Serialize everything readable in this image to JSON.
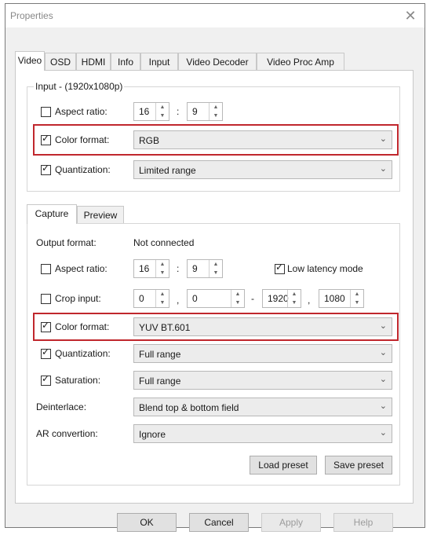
{
  "window": {
    "title": "Properties",
    "close_glyph": "✕"
  },
  "tabs": [
    {
      "label": "Video"
    },
    {
      "label": "OSD"
    },
    {
      "label": "HDMI"
    },
    {
      "label": "Info"
    },
    {
      "label": "Input"
    },
    {
      "label": "Video Decoder"
    },
    {
      "label": "Video Proc Amp"
    }
  ],
  "input_group": {
    "title": "Input - (1920x1080p)",
    "aspect_ratio": {
      "label": "Aspect ratio:",
      "checked": false,
      "a": "16",
      "b": "9"
    },
    "color_format": {
      "label": "Color format:",
      "checked": true,
      "value": "RGB"
    },
    "quantization": {
      "label": "Quantization:",
      "checked": true,
      "value": "Limited range"
    }
  },
  "inner_tabs": [
    {
      "label": "Capture"
    },
    {
      "label": "Preview"
    }
  ],
  "capture": {
    "output_format": {
      "label": "Output format:",
      "value": "Not connected"
    },
    "aspect_ratio": {
      "label": "Aspect ratio:",
      "checked": false,
      "a": "16",
      "b": "9"
    },
    "low_latency": {
      "label": "Low latency mode",
      "checked": true
    },
    "crop": {
      "label": "Crop input:",
      "checked": false,
      "x": "0",
      "y": "0",
      "w": "1920",
      "h": "1080",
      "sep1": ",",
      "sep2": "-",
      "sep3": ","
    },
    "color_format": {
      "label": "Color format:",
      "checked": true,
      "value": "YUV BT.601"
    },
    "quantization": {
      "label": "Quantization:",
      "checked": true,
      "value": "Full range"
    },
    "saturation": {
      "label": "Saturation:",
      "checked": true,
      "value": "Full range"
    },
    "deinterlace": {
      "label": "Deinterlace:",
      "value": "Blend top & bottom field"
    },
    "ar_convertion": {
      "label": "AR convertion:",
      "value": "Ignore"
    },
    "load_preset": "Load preset",
    "save_preset": "Save preset"
  },
  "buttons": {
    "ok": "OK",
    "cancel": "Cancel",
    "apply": "Apply",
    "help": "Help"
  },
  "glyphs": {
    "check": "✓",
    "up": "▲",
    "down": "▼",
    "combo": "⌄",
    "colon": ":"
  },
  "colors": {
    "highlight": "#c0272d"
  }
}
